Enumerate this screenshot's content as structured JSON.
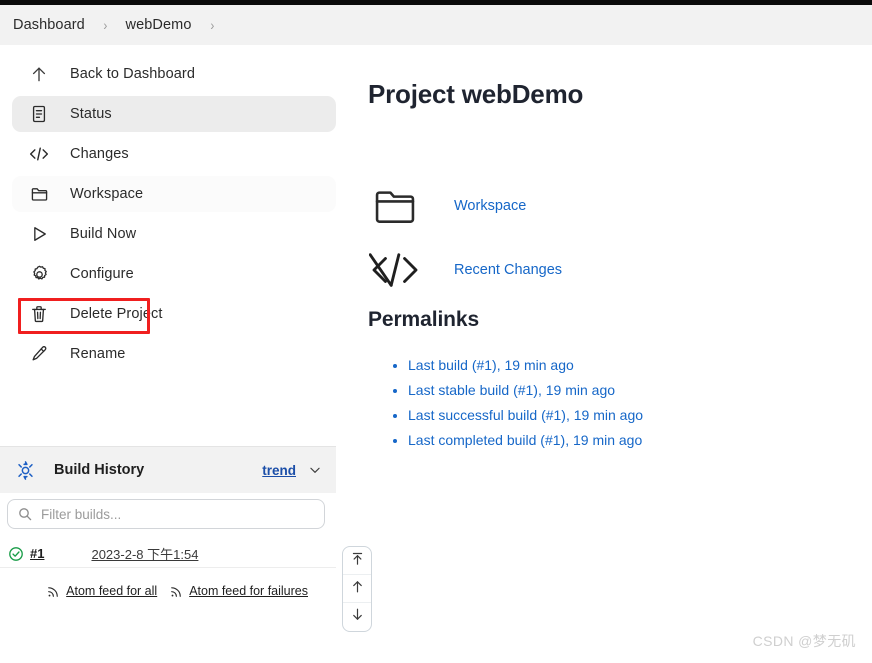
{
  "breadcrumb": {
    "items": [
      "Dashboard",
      "webDemo"
    ],
    "separator": "›"
  },
  "sidebar": {
    "items": [
      {
        "label": "Back to Dashboard",
        "icon": "arrow-up-icon",
        "state": "normal"
      },
      {
        "label": "Status",
        "icon": "document-icon",
        "state": "active"
      },
      {
        "label": "Changes",
        "icon": "code-icon",
        "state": "normal"
      },
      {
        "label": "Workspace",
        "icon": "folder-icon",
        "state": "faint"
      },
      {
        "label": "Build Now",
        "icon": "play-icon",
        "state": "normal"
      },
      {
        "label": "Configure",
        "icon": "gear-icon",
        "state": "marked"
      },
      {
        "label": "Delete Project",
        "icon": "trash-icon",
        "state": "normal"
      },
      {
        "label": "Rename",
        "icon": "pencil-icon",
        "state": "normal"
      }
    ]
  },
  "annotation": {
    "color": "#f01f1f",
    "target": "Configure"
  },
  "build_history": {
    "title": "Build History",
    "icon": "weather-vane-icon",
    "trend_label": "trend",
    "chevron_icon": "chevron-down-icon",
    "filter_placeholder": "Filter builds...",
    "filter_value": "",
    "search_icon": "search-icon",
    "builds": [
      {
        "status": "success",
        "status_icon": "check-circle-icon",
        "number": "#1",
        "timestamp": "2023-2-8 下午1:54"
      }
    ],
    "feeds": [
      {
        "label": "Atom feed for all",
        "icon": "rss-icon"
      },
      {
        "label": "Atom feed for failures",
        "icon": "rss-icon"
      }
    ]
  },
  "scroll_buttons": [
    {
      "name": "jump-to-top",
      "icon": "arrow-to-top-icon"
    },
    {
      "name": "scroll-up",
      "icon": "arrow-up-icon"
    },
    {
      "name": "scroll-down",
      "icon": "arrow-down-icon"
    }
  ],
  "main": {
    "title": "Project webDemo",
    "big_links": [
      {
        "label": "Workspace",
        "icon": "folder-icon"
      },
      {
        "label": "Recent Changes",
        "icon": "code-icon"
      }
    ],
    "permalinks_title": "Permalinks",
    "permalinks": [
      "Last build (#1), 19 min ago",
      "Last stable build (#1), 19 min ago",
      "Last successful build (#1), 19 min ago",
      "Last completed build (#1), 19 min ago"
    ]
  },
  "watermark": "CSDN @梦无矶",
  "colors": {
    "link": "#1667c8",
    "annotation": "#f01f1f",
    "success": "#1a9e4b",
    "trend_link": "#1b4ea8"
  }
}
